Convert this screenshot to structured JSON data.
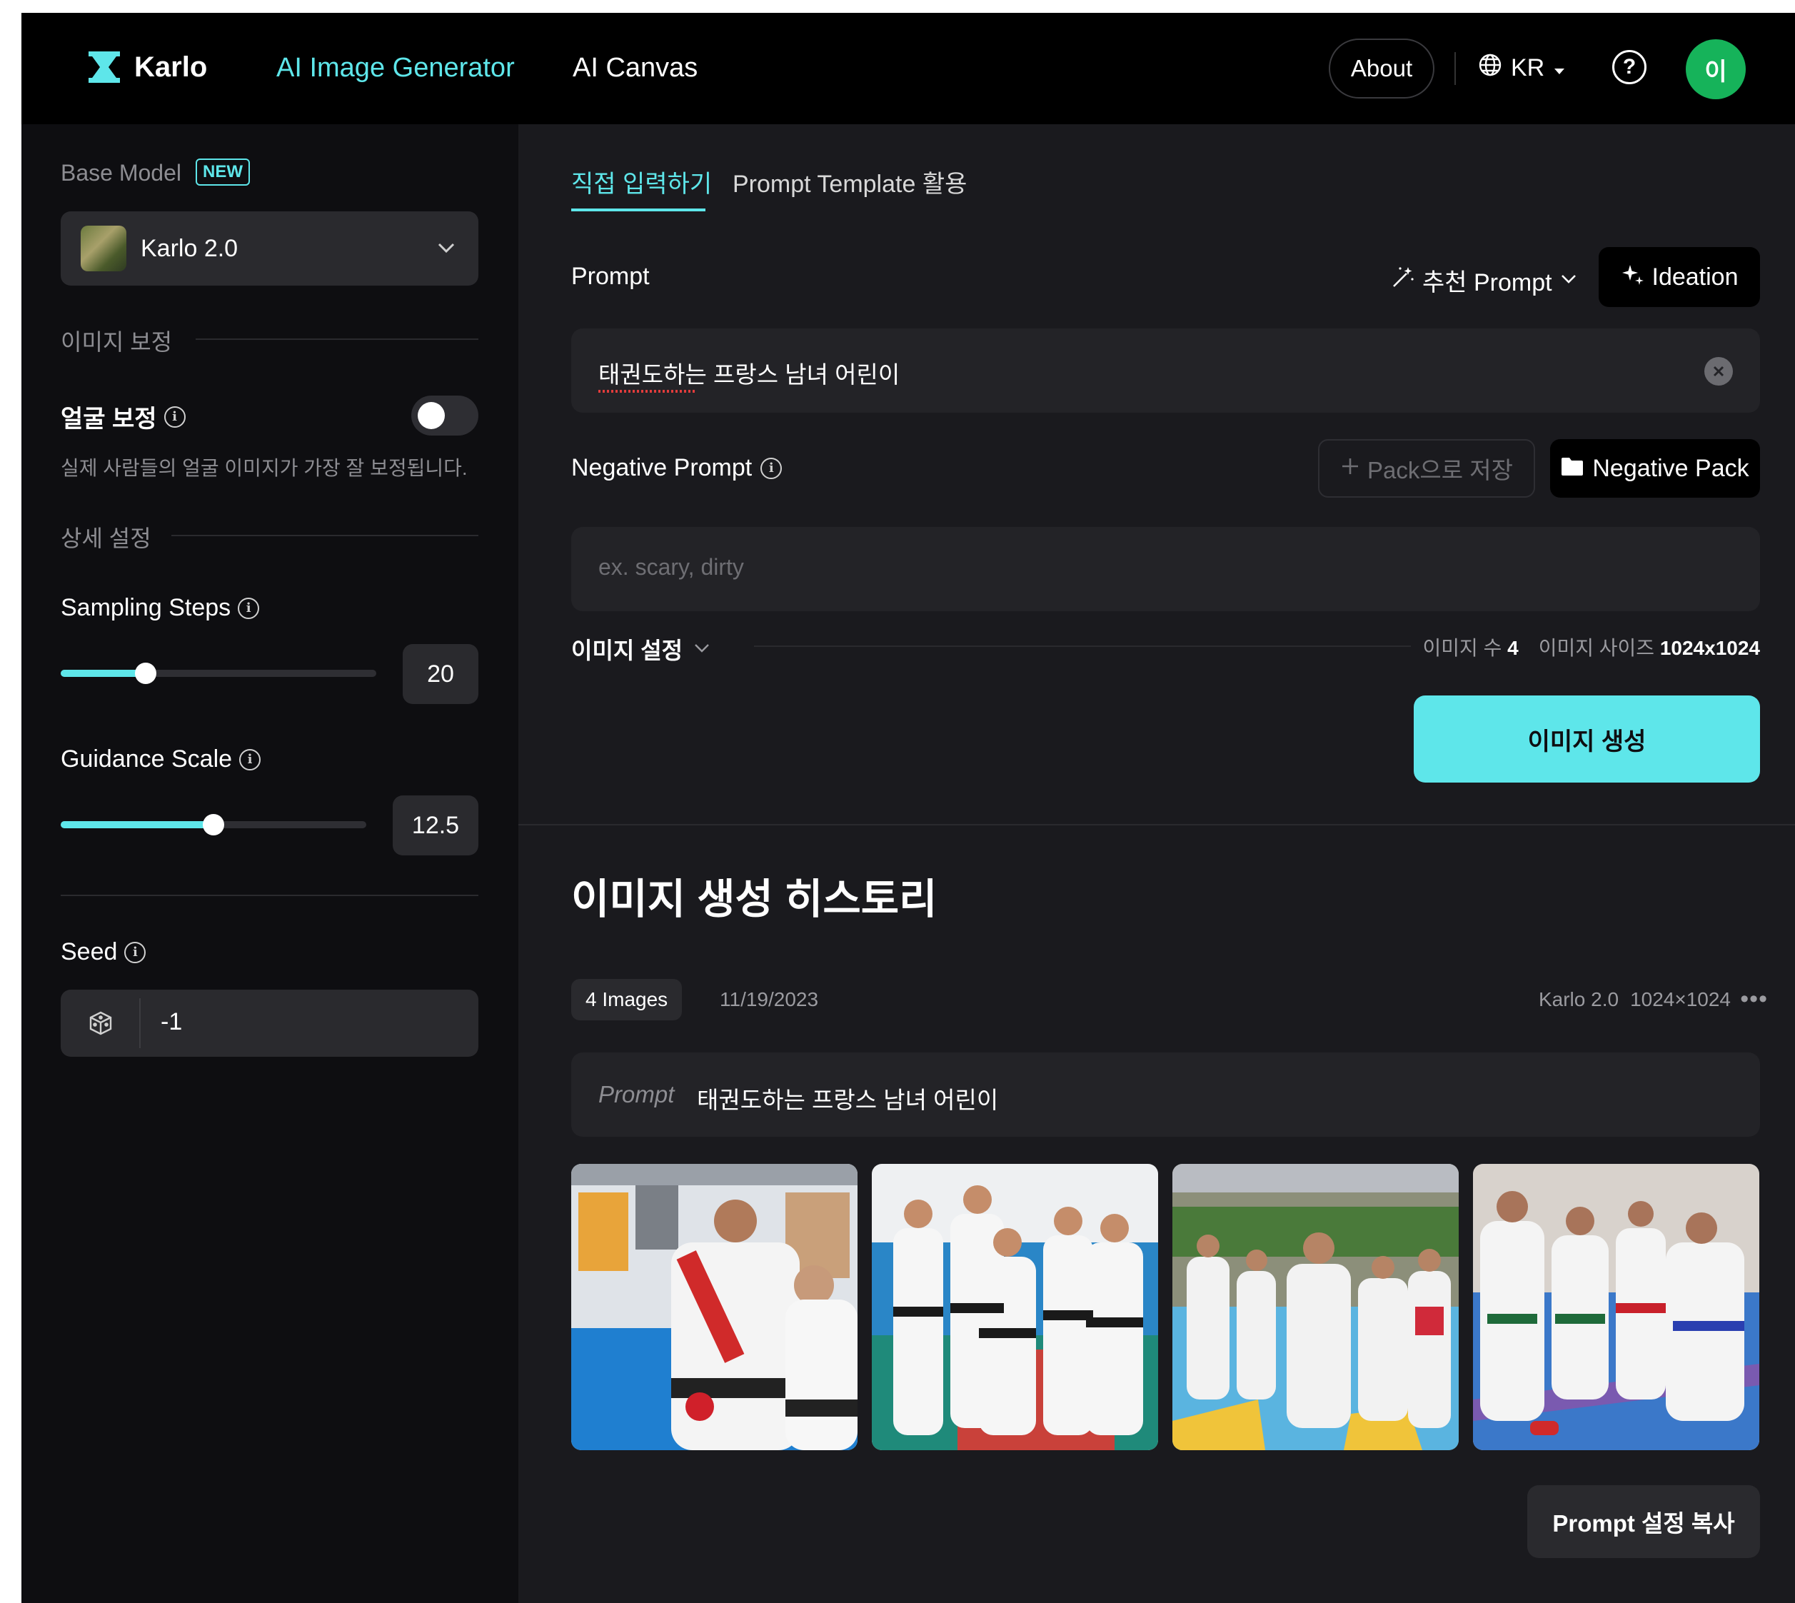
{
  "brand": {
    "name": "Karlo"
  },
  "nav": {
    "generator": "AI Image Generator",
    "canvas": "AI Canvas"
  },
  "header": {
    "about": "About",
    "language": "KR",
    "help": "?",
    "avatar_initial": "이"
  },
  "sidebar": {
    "base_model_label": "Base Model",
    "new_badge": "NEW",
    "model_name": "Karlo 2.0",
    "image_correction_heading": "이미지 보정",
    "face_correction_label": "얼굴 보정",
    "face_correction_desc": "실제 사람들의 얼굴 이미지가 가장 잘 보정됩니다.",
    "face_correction_enabled": false,
    "detail_settings_heading": "상세 설정",
    "sampling_steps_label": "Sampling Steps",
    "sampling_steps_value": "20",
    "sampling_steps_fraction": 0.27,
    "guidance_scale_label": "Guidance Scale",
    "guidance_scale_value": "12.5",
    "guidance_scale_fraction": 0.5,
    "seed_label": "Seed",
    "seed_value": "-1"
  },
  "main": {
    "tabs": [
      "직접 입력하기",
      "Prompt Template 활용"
    ],
    "prompt_label": "Prompt",
    "recommended_prompt": "추천 Prompt",
    "ideation_button": "Ideation",
    "prompt_value": "태권도하는 프랑스 남녀 어린이",
    "negative_prompt_label": "Negative Prompt",
    "pack_save_button": "Pack으로 저장",
    "negative_pack_button": "Negative Pack",
    "negative_placeholder": "ex. scary, dirty",
    "image_settings_label": "이미지 설정",
    "image_count_label": "이미지 수",
    "image_count_value": "4",
    "image_size_label": "이미지 사이즈",
    "image_size_value": "1024x1024",
    "generate_button": "이미지 생성"
  },
  "history": {
    "title": "이미지 생성 히스토리",
    "count_badge": "4 Images",
    "date": "11/19/2023",
    "model": "Karlo 2.0",
    "size": "1024×1024",
    "prompt_label": "Prompt",
    "prompt_text": "태권도하는 프랑스 남녀 어린이",
    "copy_button": "Prompt 설정 복사"
  },
  "colors": {
    "accent": "#5ee6ea",
    "avatar": "#16b35a",
    "background": "#0e0e11",
    "panel": "#1a1a1e"
  }
}
